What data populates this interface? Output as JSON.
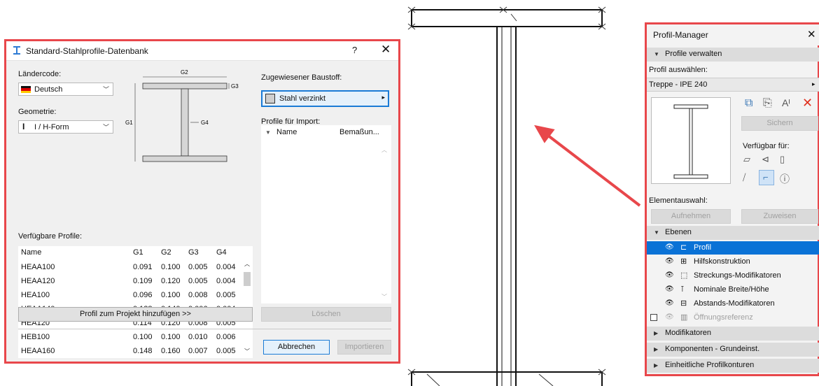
{
  "dialog": {
    "title": "Standard-Stahlprofile-Datenbank",
    "help": "?",
    "close": "✕",
    "country_label": "Ländercode:",
    "country_value": "Deutsch",
    "geometry_label": "Geometrie:",
    "geometry_value": "I / H-Form",
    "diagram_labels": {
      "g1": "G1",
      "g2": "G2",
      "g3": "G3",
      "g4": "G4"
    },
    "available_label": "Verfügbare Profile:",
    "table": {
      "headers": [
        "Name",
        "G1",
        "G2",
        "G3",
        "G4"
      ],
      "rows": [
        [
          "HEAA100",
          "0.091",
          "0.100",
          "0.005",
          "0.004"
        ],
        [
          "HEAA120",
          "0.109",
          "0.120",
          "0.005",
          "0.004"
        ],
        [
          "HEA100",
          "0.096",
          "0.100",
          "0.008",
          "0.005"
        ],
        [
          "HEAA140",
          "0.128",
          "0.140",
          "0.006",
          "0.004"
        ],
        [
          "HEA120",
          "0.114",
          "0.120",
          "0.008",
          "0.005"
        ],
        [
          "HEB100",
          "0.100",
          "0.100",
          "0.010",
          "0.006"
        ],
        [
          "HEAA160",
          "0.148",
          "0.160",
          "0.007",
          "0.005"
        ]
      ]
    },
    "add_button": "Profil zum Projekt hinzufügen >>",
    "material_label": "Zugewiesener Baustoff:",
    "material_value": "Stahl verzinkt",
    "import_label": "Profile für Import:",
    "import_headers": [
      "Name",
      "Bemaßun..."
    ],
    "delete_button": "Löschen",
    "cancel_button": "Abbrechen",
    "import_button": "Importieren"
  },
  "profile_manager": {
    "title": "Profil-Manager",
    "close": "✕",
    "manage_section": "Profile verwalten",
    "select_label": "Profil auswählen:",
    "selected_profile": "Treppe - IPE 240",
    "save_button": "Sichern",
    "available_for": "Verfügbar für:",
    "element_selection": "Elementauswahl:",
    "pick_button": "Aufnehmen",
    "assign_button": "Zuweisen",
    "layers_section": "Ebenen",
    "layers": [
      {
        "label": "Profil",
        "selected": true
      },
      {
        "label": "Hilfskonstruktion"
      },
      {
        "label": "Streckungs-Modifikatoren"
      },
      {
        "label": "Nominale Breite/Höhe"
      },
      {
        "label": "Abstands-Modifikatoren"
      },
      {
        "label": "Öffnungsreferenz",
        "disabled": true
      }
    ],
    "sections": [
      "Modifikatoren",
      "Komponenten - Grundeinst.",
      "Einheitliche Profilkonturen"
    ]
  },
  "colors": {
    "highlight": "#e8474b",
    "selection": "#0a72d6",
    "accent_icon": "#3a77b5",
    "delete_icon": "#e0301e"
  }
}
